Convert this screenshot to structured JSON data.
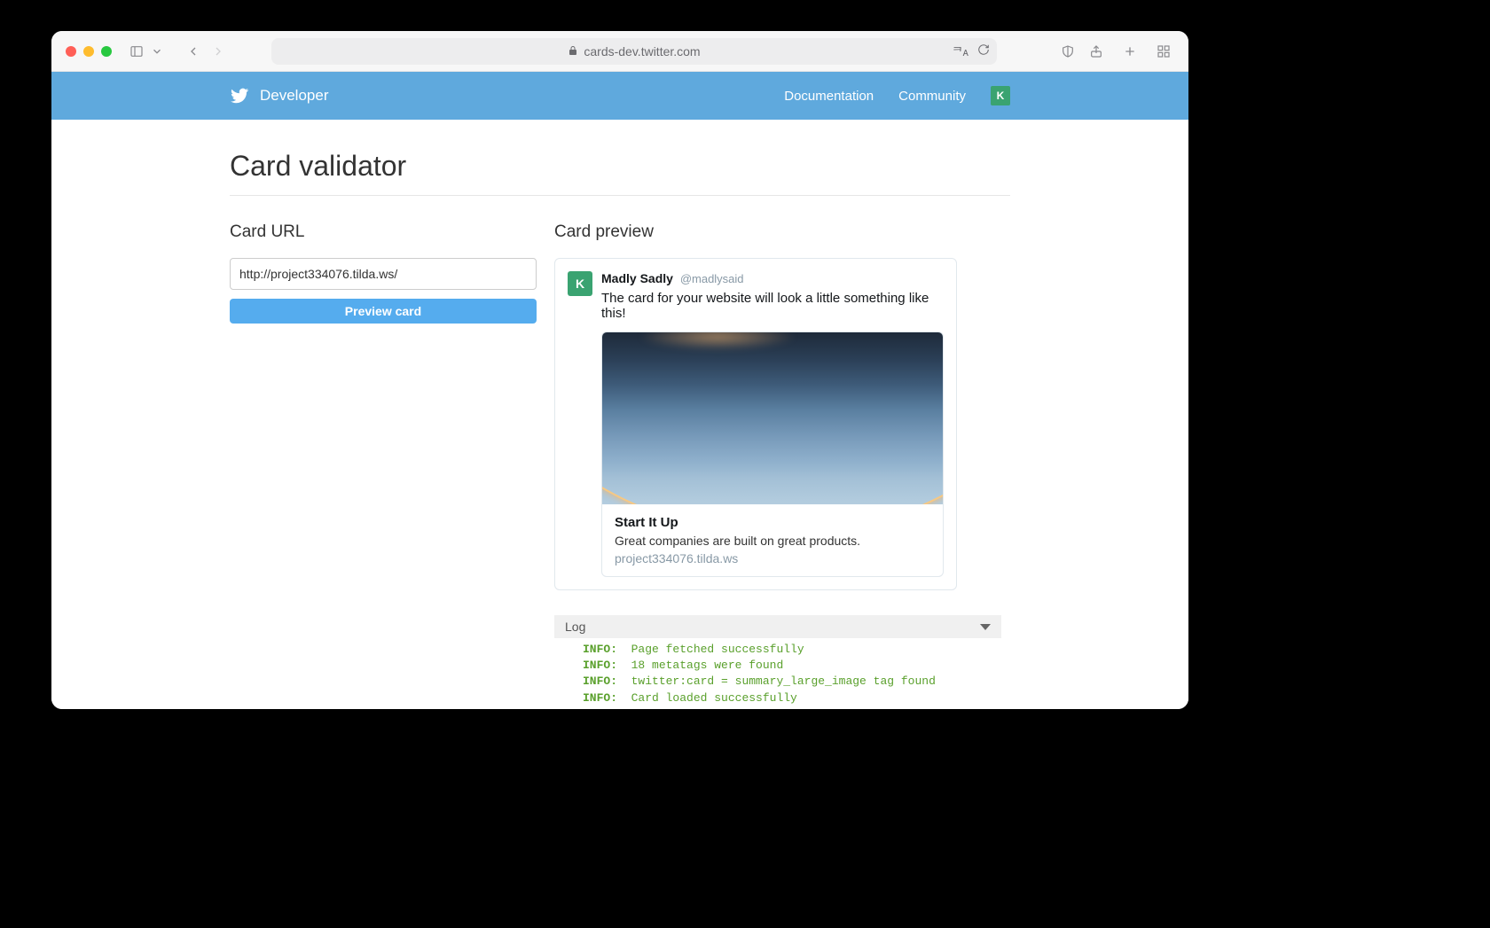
{
  "browser": {
    "url": "cards-dev.twitter.com"
  },
  "header": {
    "brand": "Developer",
    "nav": {
      "docs": "Documentation",
      "community": "Community"
    },
    "avatar_letter": "K"
  },
  "page": {
    "title": "Card validator",
    "url_label": "Card URL",
    "preview_label": "Card preview",
    "url_value": "http://project334076.tilda.ws/",
    "preview_btn": "Preview card"
  },
  "tweet": {
    "avatar_letter": "K",
    "name": "Madly Sadly",
    "handle": "@madlysaid",
    "text": "The card for your website will look a little something like this!"
  },
  "card": {
    "title": "Start It Up",
    "desc": "Great companies are built on great products.",
    "domain": "project334076.tilda.ws"
  },
  "log": {
    "label": "Log",
    "lines": [
      {
        "level": "INFO:",
        "msg": "Page fetched successfully"
      },
      {
        "level": "INFO:",
        "msg": "18 metatags were found"
      },
      {
        "level": "INFO:",
        "msg": "twitter:card = summary_large_image tag found"
      },
      {
        "level": "INFO:",
        "msg": "Card loaded successfully"
      }
    ]
  }
}
